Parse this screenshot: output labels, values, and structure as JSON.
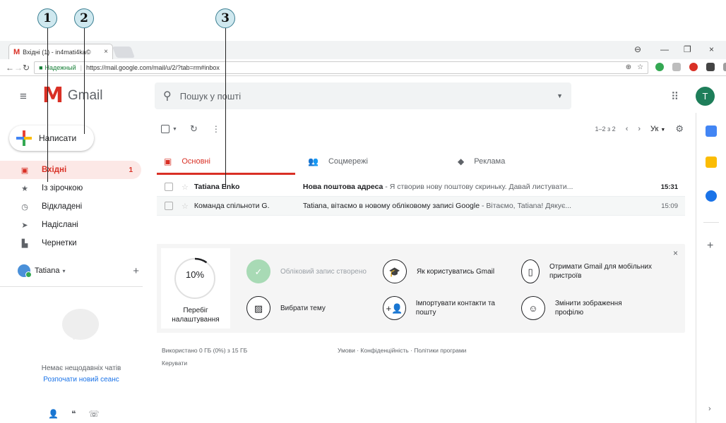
{
  "callouts": [
    "1",
    "2",
    "3"
  ],
  "browser": {
    "tab_title": "Вхідні (1) - in4mati4ka©",
    "tab_close": "×",
    "window_controls": [
      "⊖",
      "—",
      "❐",
      "×"
    ],
    "secure_label": "Надежный",
    "url": "https://mail.google.com/mail/u/2/?tab=rm#inbox"
  },
  "app": {
    "logo_letter": "M",
    "logo_text": "Gmail",
    "search_placeholder": "Пошук у пошті",
    "avatar_letter": "T"
  },
  "compose": {
    "label": "Написати"
  },
  "sidebar": {
    "items": [
      {
        "label": "Вхідні",
        "count": "1",
        "icon": "inbox-icon",
        "glyph": "▣",
        "active": true
      },
      {
        "label": "Із зірочкою",
        "count": "",
        "icon": "star-icon",
        "glyph": "★",
        "active": false
      },
      {
        "label": "Відкладені",
        "count": "",
        "icon": "clock-icon",
        "glyph": "◷",
        "active": false
      },
      {
        "label": "Надіслані",
        "count": "",
        "icon": "send-icon",
        "glyph": "➤",
        "active": false
      },
      {
        "label": "Чернетки",
        "count": "",
        "icon": "draft-icon",
        "glyph": "▙",
        "active": false
      }
    ],
    "hangouts_user": "Tatiana",
    "hangouts_caret": "▾",
    "no_chats": "Немає нещодавніх чатів",
    "start_session": "Розпочати новий сеанс"
  },
  "toolbar": {
    "pagination": "1–2 з 2",
    "lang": "Ук"
  },
  "tabs": [
    {
      "label": "Основні",
      "icon": "inbox-tab-icon",
      "glyph": "▣",
      "active": true
    },
    {
      "label": "Соцмережі",
      "icon": "people-icon",
      "glyph": "👥",
      "active": false
    },
    {
      "label": "Реклама",
      "icon": "tag-icon",
      "glyph": "◆",
      "active": false
    }
  ],
  "messages": [
    {
      "sender": "Tatiana Enko",
      "subject": "Нова поштова адреса",
      "snippet": " - Я створив нову поштову скриньку. Давай листувати...",
      "time": "15:31",
      "unread": true
    },
    {
      "sender": "Команда спільноти G.",
      "subject": "Tatiana, вітаємо в новому обліковому записі Google",
      "snippet": " - Вітаємо, Tatiana! Дякує...",
      "time": "15:09",
      "unread": false
    }
  ],
  "setup": {
    "progress": 0.1,
    "progress_text": "10%",
    "progress_label": "Перебіг налаштування",
    "items": [
      {
        "text": "Обліковий запис створено",
        "icon": "check-icon",
        "glyph": "✓",
        "done": true
      },
      {
        "text": "Як користуватись Gmail",
        "icon": "graduation-cap-icon",
        "glyph": "🎓",
        "done": false
      },
      {
        "text": "Отримати Gmail для мобільних пристроїв",
        "icon": "phone-icon",
        "glyph": "▯",
        "done": false
      },
      {
        "text": "Вибрати тему",
        "icon": "image-icon",
        "glyph": "▨",
        "done": false
      },
      {
        "text": "Імпортувати контакти та пошту",
        "icon": "add-person-icon",
        "glyph": "+👤",
        "done": false
      },
      {
        "text": "Змінити зображення профілю",
        "icon": "account-icon",
        "glyph": "☺",
        "done": false
      }
    ]
  },
  "footer": {
    "storage": "Використано 0 ГБ (0%) з 15 ГБ",
    "manage": "Керувати",
    "links": "Умови · Конфіденційність · Політики програми"
  }
}
